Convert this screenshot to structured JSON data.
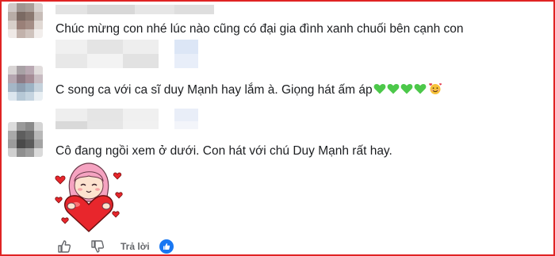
{
  "comments": [
    {
      "text": "Chúc mừng con nhé lúc nào cũng có đại gia đình xanh chuối bên cạnh con",
      "avatar_icon": "blurred-avatar-icon"
    },
    {
      "text": "C song ca với ca sĩ duy Mạnh hay lắm à. Giọng hát ấm áp",
      "emojis": [
        "green-heart",
        "green-heart",
        "green-heart",
        "green-heart",
        "smiling-face-with-hearts"
      ],
      "avatar_icon": "blurred-avatar-icon"
    },
    {
      "text": "Cô đang ngồi xem ở dưới. Con hát với chú Duy Mạnh rất hay.",
      "sticker_icon": "girl-hugging-heart-sticker",
      "avatar_icon": "blurred-avatar-icon"
    }
  ],
  "actions": {
    "like_icon": "thumbs-up-icon",
    "dislike_icon": "thumbs-down-icon",
    "reply_label": "Trả lời",
    "reaction_icon": "like-reaction-icon"
  },
  "colors": {
    "frame_border": "#e02424",
    "green_heart": "#4cc84a",
    "like_blue": "#1877f2",
    "sticker_heart": "#e8262c",
    "sticker_hair": "#f5a3c1"
  }
}
